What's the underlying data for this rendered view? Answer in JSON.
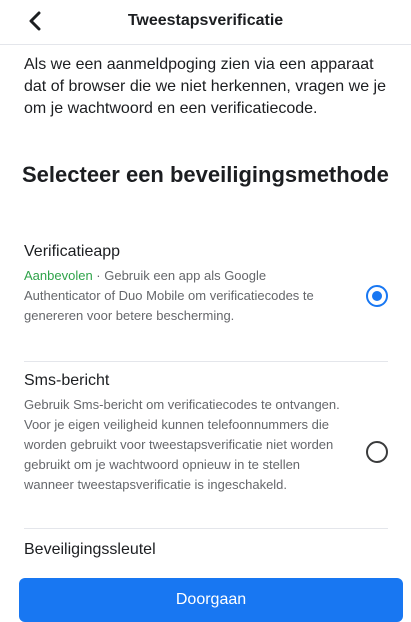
{
  "header": {
    "title": "Tweestapsverificatie",
    "back_icon": "chevron-left-icon"
  },
  "intro": "Als we een aanmeldpoging zien via een apparaat dat of browser die we niet herkennen, vragen we je om je wachtwoord en een verificatiecode.",
  "heading": "Selecteer een beveiligingsmethode",
  "options": [
    {
      "title": "Verificatieapp",
      "badge": "Aanbevolen",
      "separator": " · ",
      "description": "Gebruik een app als Google Authenticator of Duo Mobile om verificatiecodes te genereren voor betere bescherming.",
      "selected": true
    },
    {
      "title": "Sms-bericht",
      "description": "Gebruik Sms-bericht om verificatiecodes te ontvangen. Voor je eigen veiligheid kunnen telefoonnummers die worden gebruikt voor tweestapsverificatie niet worden gebruikt om je wachtwoord opnieuw in te stellen wanneer tweestapsverificatie is ingeschakeld.",
      "selected": false
    },
    {
      "title": "Beveiligingssleutel"
    }
  ],
  "continue_label": "Doorgaan",
  "colors": {
    "accent": "#1877f2",
    "recommended": "#2fa34a",
    "muted_text": "#65676b"
  }
}
